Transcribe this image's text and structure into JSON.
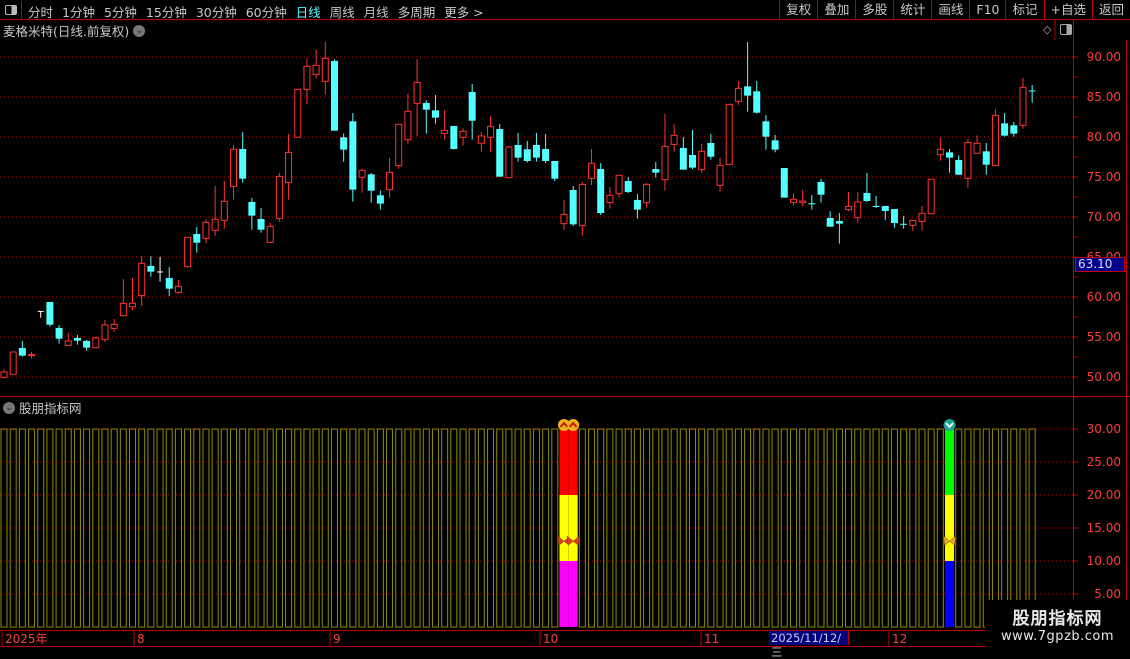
{
  "toolbar": {
    "periods": [
      "分时",
      "1分钟",
      "5分钟",
      "15分钟",
      "30分钟",
      "60分钟",
      "日线",
      "周线",
      "月线",
      "多周期",
      "更多 >"
    ],
    "active_period": "日线",
    "buttons": [
      "复权",
      "叠加",
      "多股",
      "统计",
      "画线",
      "F10",
      "标记",
      "+自选",
      "返回"
    ]
  },
  "main": {
    "title": "麦格米特(日线.前复权)",
    "current_price_label": "63.10",
    "y_labels": [
      "90.00",
      "85.00",
      "80.00",
      "75.00",
      "70.00",
      "65.00",
      "60.00",
      "55.00",
      "50.00"
    ],
    "y_values": [
      90,
      85,
      80,
      75,
      70,
      65,
      60,
      55,
      50
    ],
    "colors": {
      "up": "#ff3232",
      "down": "#54ffff",
      "flat": "#ffffff",
      "grid": "#b00000",
      "axis": "#c00000",
      "price_label": "#ff3c3c"
    },
    "candles": [
      [
        49.96,
        50.63,
        50.96,
        49.83
      ],
      [
        50.33,
        53.13,
        53.13,
        50.33
      ],
      [
        53.63,
        52.67,
        54.5,
        52.54
      ],
      [
        52.7,
        52.8,
        53.13,
        52.3
      ],
      [
        58.2,
        58.2,
        58.2,
        57.4
      ],
      [
        59.38,
        56.54,
        59.38,
        56.3
      ],
      [
        56.13,
        54.79,
        56.5,
        54.17
      ],
      [
        53.96,
        54.5,
        55.5,
        53.96
      ],
      [
        54.88,
        54.54,
        55.25,
        54.04
      ],
      [
        54.5,
        53.67,
        54.63,
        53.3
      ],
      [
        53.67,
        54.88,
        55,
        53.67
      ],
      [
        54.67,
        56.5,
        57.13,
        54.38
      ],
      [
        56.08,
        56.58,
        57.25,
        55.67
      ],
      [
        57.67,
        59.21,
        62.25,
        57.67
      ],
      [
        58.79,
        59.21,
        62.38,
        58.29
      ],
      [
        60.17,
        64.21,
        65.13,
        58.88
      ],
      [
        63.88,
        63.17,
        65.13,
        62.54
      ],
      [
        63.13,
        63.13,
        65,
        61.92
      ],
      [
        62.38,
        61.04,
        63.75,
        60.13
      ],
      [
        60.58,
        61.33,
        62.13,
        60.42
      ],
      [
        63.79,
        67.46,
        67.46,
        63.67
      ],
      [
        67.88,
        66.79,
        68.75,
        65.54
      ],
      [
        67.33,
        69.33,
        69.71,
        66.71
      ],
      [
        68.33,
        69.71,
        73.88,
        67.67
      ],
      [
        69.58,
        71.96,
        74.5,
        68.54
      ],
      [
        73.83,
        78.46,
        78.96,
        72.17
      ],
      [
        78.5,
        74.79,
        80.63,
        74.29
      ],
      [
        71.88,
        70.17,
        72.38,
        68.42
      ],
      [
        69.75,
        68.42,
        71.13,
        68.04
      ],
      [
        66.83,
        68.83,
        69.25,
        66.83
      ],
      [
        69.83,
        75.08,
        75.5,
        69.42
      ],
      [
        74.33,
        78.08,
        80.38,
        72.17
      ],
      [
        79.96,
        85.96,
        85.96,
        79.96
      ],
      [
        85.96,
        88.83,
        89.83,
        84.08
      ],
      [
        87.83,
        88.96,
        90.88,
        87.29
      ],
      [
        86.96,
        89.83,
        91.88,
        85.33
      ],
      [
        89.5,
        80.79,
        89.71,
        80.79
      ],
      [
        79.96,
        78.42,
        80.46,
        76.92
      ],
      [
        81.96,
        73.42,
        83,
        71.92
      ],
      [
        74.96,
        75.83,
        76,
        73.04
      ],
      [
        75.33,
        73.29,
        75.5,
        71.79
      ],
      [
        72.71,
        71.67,
        73.33,
        70.92
      ],
      [
        73.42,
        75.58,
        77.38,
        72.42
      ],
      [
        76.42,
        81.58,
        81.58,
        76.04
      ],
      [
        79.67,
        83.21,
        85.38,
        79.17
      ],
      [
        84.21,
        86.83,
        89.75,
        80.13
      ],
      [
        84.25,
        83.42,
        84.58,
        80.42
      ],
      [
        83.33,
        82.42,
        85.25,
        81.67
      ],
      [
        80.46,
        80.83,
        83.38,
        79.67
      ],
      [
        81.38,
        78.5,
        81.38,
        78.42
      ],
      [
        79.96,
        80.71,
        81.08,
        78.92
      ],
      [
        85.63,
        82.04,
        86.63,
        79.67
      ],
      [
        79.21,
        80.13,
        80.63,
        78.17
      ],
      [
        79.96,
        81.33,
        82.63,
        78.17
      ],
      [
        81,
        75.04,
        81.63,
        75.04
      ],
      [
        74.92,
        78.75,
        78.88,
        74.83
      ],
      [
        79,
        77.42,
        80.5,
        76.92
      ],
      [
        78.46,
        77,
        79.5,
        76.8
      ],
      [
        79,
        77.42,
        80.5,
        76.92
      ],
      [
        78.5,
        77,
        80.38,
        76.75
      ],
      [
        77,
        74.79,
        77,
        74.5
      ],
      [
        69.17,
        70.33,
        72.13,
        68.38
      ],
      [
        73.38,
        69.08,
        73.88,
        68.88
      ],
      [
        68.92,
        74.08,
        74.38,
        67.63
      ],
      [
        74.83,
        76.71,
        78.5,
        74
      ],
      [
        76,
        70.5,
        76.75,
        70.25
      ],
      [
        71.79,
        72.71,
        73.75,
        71.04
      ],
      [
        72.92,
        75.21,
        75.21,
        72.42
      ],
      [
        74.5,
        73.13,
        75,
        73
      ],
      [
        72.13,
        70.92,
        72.88,
        69.79
      ],
      [
        71.79,
        74.08,
        74.25,
        71.17
      ],
      [
        76,
        75.54,
        76.88,
        74.92
      ],
      [
        74.67,
        78.83,
        82.88,
        73.29
      ],
      [
        79.08,
        80.21,
        81.58,
        78.17
      ],
      [
        78.63,
        75.92,
        80,
        75.92
      ],
      [
        77.75,
        76.17,
        80.88,
        76
      ],
      [
        75.92,
        78.21,
        79.13,
        75.54
      ],
      [
        79.25,
        77.54,
        80.38,
        77.17
      ],
      [
        73.96,
        76.46,
        77.38,
        73.17
      ],
      [
        76.58,
        84.08,
        84.08,
        76.58
      ],
      [
        84.46,
        86.08,
        87,
        84.04
      ],
      [
        86.33,
        85.17,
        91.88,
        83.17
      ],
      [
        85.71,
        83.04,
        87,
        82.92
      ],
      [
        81.96,
        80.04,
        82.75,
        78.42
      ],
      [
        79.58,
        78.42,
        80.25,
        78.08
      ],
      [
        76.13,
        72.42,
        76.13,
        72.42
      ],
      [
        71.83,
        72.21,
        72.96,
        71.42
      ],
      [
        71.79,
        72,
        73.38,
        71.29
      ],
      [
        71.72,
        71.7,
        72.75,
        70.92
      ],
      [
        74.38,
        72.79,
        74.75,
        71.79
      ],
      [
        69.88,
        68.79,
        70.71,
        68.79
      ],
      [
        69.5,
        69.17,
        70.5,
        66.67
      ],
      [
        70.92,
        71.33,
        73.13,
        70.75
      ],
      [
        69.92,
        71.88,
        73.13,
        69.29
      ],
      [
        73,
        72,
        75.5,
        71.88
      ],
      [
        71.38,
        71.3,
        72.63,
        71.13
      ],
      [
        71.38,
        70.75,
        71.38,
        69.63
      ],
      [
        71,
        69.25,
        71,
        68.67
      ],
      [
        69.15,
        69.1,
        70.13,
        68.54
      ],
      [
        68.96,
        69.58,
        69.58,
        68.29
      ],
      [
        69.46,
        70.46,
        71.38,
        68.29
      ],
      [
        70.42,
        74.71,
        74.71,
        70.42
      ],
      [
        77.79,
        78.46,
        79.88,
        77.04
      ],
      [
        78.08,
        77.42,
        78.5,
        75.54
      ],
      [
        77.13,
        75.29,
        77.71,
        75.29
      ],
      [
        74.83,
        79.33,
        79.75,
        73.67
      ],
      [
        77.96,
        79.21,
        80.21,
        77.96
      ],
      [
        78.21,
        76.54,
        79.25,
        75.29
      ],
      [
        76.42,
        82.71,
        83.46,
        76.42
      ],
      [
        81.71,
        80.17,
        83,
        80.04
      ],
      [
        81.46,
        80.42,
        81.88,
        80.04
      ],
      [
        81.46,
        86.21,
        87.38,
        81.04
      ],
      [
        85.82,
        85.8,
        86.5,
        84.3
      ]
    ]
  },
  "indicator": {
    "title": "股朋指标网",
    "y_labels": [
      "30.00",
      "25.00",
      "20.00",
      "15.00",
      "10.00",
      "5.00"
    ],
    "y_values": [
      30,
      25,
      20,
      15,
      10,
      5
    ],
    "bar_value": 30,
    "bar_color": "#8c8c00",
    "signals": [
      {
        "index": 61,
        "top_icon": "up-chevron-badge-icon",
        "mid_icon": "butterfly-icon",
        "mid_value": 13,
        "segments": [
          {
            "from": 20,
            "to": 30,
            "color": "#ff0000"
          },
          {
            "from": 10,
            "to": 20,
            "color": "#ffff00"
          },
          {
            "from": 0,
            "to": 10,
            "color": "#ff00ff"
          }
        ]
      },
      {
        "index": 62,
        "top_icon": "up-chevron-badge-icon",
        "mid_icon": "butterfly-icon",
        "mid_value": 13,
        "segments": [
          {
            "from": 20,
            "to": 30,
            "color": "#ff0000"
          },
          {
            "from": 10,
            "to": 20,
            "color": "#ffff00"
          },
          {
            "from": 0,
            "to": 10,
            "color": "#ff00ff"
          }
        ]
      },
      {
        "index": 103,
        "top_icon": "down-chevron-badge-icon",
        "mid_icon": "butterfly-icon",
        "mid_value": 13,
        "segments": [
          {
            "from": 20,
            "to": 30,
            "color": "#00ff00"
          },
          {
            "from": 10,
            "to": 20,
            "color": "#ffff00"
          },
          {
            "from": 0,
            "to": 10,
            "color": "#0000ff"
          }
        ]
      }
    ]
  },
  "date_axis": {
    "labels": [
      "2025年",
      "8",
      "9",
      "10",
      "11",
      "12"
    ],
    "highlight": "2025/11/12/三"
  },
  "watermark": {
    "name": "股朋指标网",
    "url": "www.7gpzb.com"
  }
}
